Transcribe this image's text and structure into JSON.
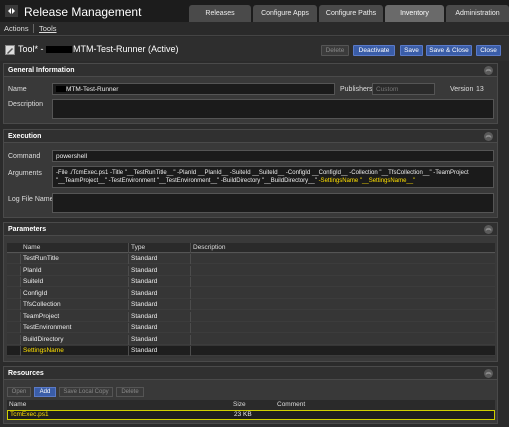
{
  "app": {
    "title": "Release Management"
  },
  "tabs": [
    {
      "label": "Releases"
    },
    {
      "label": "Configure Apps"
    },
    {
      "label": "Configure Paths"
    },
    {
      "label": "Inventory"
    },
    {
      "label": "Administration"
    }
  ],
  "menu": {
    "actions": "Actions",
    "tools": "Tools"
  },
  "header": {
    "title_prefix": "Tool* - ",
    "title_suffix": "MTM-Test-Runner (Active)"
  },
  "buttons": {
    "delete": "Delete",
    "deactivate": "Deactivate",
    "save": "Save",
    "save_close": "Save & Close",
    "close": "Close"
  },
  "general": {
    "section_title": "General Information",
    "name_label": "Name",
    "name_value": "MTM-Test-Runner",
    "publishers_label": "Publishers",
    "publishers_placeholder": "Custom",
    "version_label": "Version",
    "version_value": "13",
    "description_label": "Description"
  },
  "execution": {
    "section_title": "Execution",
    "command_label": "Command",
    "command_value": "powershell",
    "arguments_label": "Arguments",
    "arguments_line1": "-File ./TcmExec.ps1 -Title \"__TestRunTitle__\" -PlanId __PlanId__ -SuiteId __SuiteId__ -ConfigId __ConfigId__ -Collection \"__TfsCollection__\" -TeamProject",
    "arguments_line2": "\"__TeamProject__\" -TestEnvironment \"__TestEnvironment__\" -BuildDirectory \"__BuildDirectory__\" ",
    "arguments_line2_hl": "-SettingsName \"__SettingsName__\"",
    "logfile_label": "Log File Name"
  },
  "parameters": {
    "section_title": "Parameters",
    "columns": {
      "name": "Name",
      "type": "Type",
      "description": "Description"
    },
    "rows": [
      {
        "name": "TestRunTitle",
        "type": "Standard"
      },
      {
        "name": "PlanId",
        "type": "Standard"
      },
      {
        "name": "SuiteId",
        "type": "Standard"
      },
      {
        "name": "ConfigId",
        "type": "Standard"
      },
      {
        "name": "TfsCollection",
        "type": "Standard"
      },
      {
        "name": "TeamProject",
        "type": "Standard"
      },
      {
        "name": "TestEnvironment",
        "type": "Standard"
      },
      {
        "name": "BuildDirectory",
        "type": "Standard"
      },
      {
        "name": "SettingsName",
        "type": "Standard",
        "highlight": true
      }
    ]
  },
  "resources": {
    "section_title": "Resources",
    "buttons": {
      "open": "Open",
      "add": "Add",
      "save_local_copy": "Save Local Copy",
      "delete": "Delete"
    },
    "columns": {
      "name": "Name",
      "size": "Size",
      "comment": "Comment"
    },
    "rows": [
      {
        "name": "TcmExec.ps1",
        "size": "23 KB",
        "comment": ""
      }
    ]
  },
  "colors": {
    "accent": "#3a5da8",
    "highlight": "#ffe000"
  }
}
